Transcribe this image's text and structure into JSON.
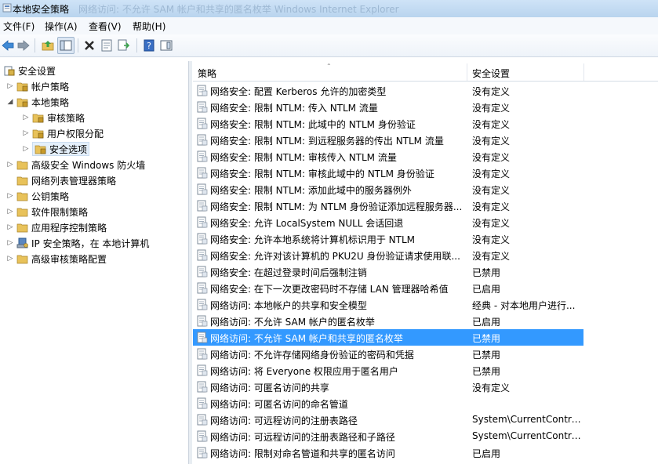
{
  "window": {
    "title": "本地安全策略",
    "ghost_title": "网络访问: 不允许 SAM 帐户和共享的匿名枚举  Windows Internet Explorer"
  },
  "menu": [
    {
      "label": "文件(F)"
    },
    {
      "label": "操作(A)"
    },
    {
      "label": "查看(V)"
    },
    {
      "label": "帮助(H)"
    }
  ],
  "toolbar": {
    "icons": [
      "back-arrow-icon",
      "forward-arrow-icon",
      "up-folder-icon",
      "show-hide-tree-icon",
      "delete-icon",
      "properties-icon",
      "export-list-icon",
      "help-icon",
      "console-pane-icon"
    ]
  },
  "tree": {
    "root": "安全设置",
    "items": [
      {
        "label": "帐户策略",
        "level": 1,
        "expander": "closed",
        "icon": "folder-lock"
      },
      {
        "label": "本地策略",
        "level": 1,
        "expander": "open",
        "icon": "folder-lock"
      },
      {
        "label": "审核策略",
        "level": 2,
        "expander": "closed",
        "icon": "folder-lock"
      },
      {
        "label": "用户权限分配",
        "level": 2,
        "expander": "closed",
        "icon": "folder-lock"
      },
      {
        "label": "安全选项",
        "level": 2,
        "expander": "closed",
        "icon": "folder-lock",
        "selected": true
      },
      {
        "label": "高级安全 Windows 防火墙",
        "level": 1,
        "expander": "closed",
        "icon": "folder"
      },
      {
        "label": "网络列表管理器策略",
        "level": 1,
        "expander": "none",
        "icon": "folder"
      },
      {
        "label": "公钥策略",
        "level": 1,
        "expander": "closed",
        "icon": "folder"
      },
      {
        "label": "软件限制策略",
        "level": 1,
        "expander": "closed",
        "icon": "folder"
      },
      {
        "label": "应用程序控制策略",
        "level": 1,
        "expander": "closed",
        "icon": "folder"
      },
      {
        "label": "IP 安全策略，在 本地计算机",
        "level": 1,
        "expander": "closed",
        "icon": "ipsec"
      },
      {
        "label": "高级审核策略配置",
        "level": 1,
        "expander": "closed",
        "icon": "folder"
      }
    ]
  },
  "table": {
    "headers": {
      "policy": "策略",
      "setting": "安全设置"
    },
    "rows": [
      {
        "policy": "网络安全: 配置 Kerberos 允许的加密类型",
        "setting": "没有定义"
      },
      {
        "policy": "网络安全: 限制 NTLM: 传入 NTLM 流量",
        "setting": "没有定义"
      },
      {
        "policy": "网络安全: 限制 NTLM: 此域中的 NTLM 身份验证",
        "setting": "没有定义"
      },
      {
        "policy": "网络安全: 限制 NTLM: 到远程服务器的传出 NTLM 流量",
        "setting": "没有定义"
      },
      {
        "policy": "网络安全: 限制 NTLM: 审核传入 NTLM 流量",
        "setting": "没有定义"
      },
      {
        "policy": "网络安全: 限制 NTLM: 审核此域中的 NTLM 身份验证",
        "setting": "没有定义"
      },
      {
        "policy": "网络安全: 限制 NTLM: 添加此域中的服务器例外",
        "setting": "没有定义"
      },
      {
        "policy": "网络安全: 限制 NTLM: 为 NTLM 身份验证添加远程服务器...",
        "setting": "没有定义"
      },
      {
        "policy": "网络安全: 允许 LocalSystem NULL 会话回退",
        "setting": "没有定义"
      },
      {
        "policy": "网络安全: 允许本地系统将计算机标识用于 NTLM",
        "setting": "没有定义"
      },
      {
        "policy": "网络安全: 允许对该计算机的 PKU2U 身份验证请求使用联...",
        "setting": "没有定义"
      },
      {
        "policy": "网络安全: 在超过登录时间后强制注销",
        "setting": "已禁用"
      },
      {
        "policy": "网络安全: 在下一次更改密码时不存储 LAN 管理器哈希值",
        "setting": "已启用"
      },
      {
        "policy": "网络访问: 本地帐户的共享和安全模型",
        "setting": "经典 - 对本地用户进行..."
      },
      {
        "policy": "网络访问: 不允许 SAM 帐户的匿名枚举",
        "setting": "已启用"
      },
      {
        "policy": "网络访问: 不允许 SAM 帐户和共享的匿名枚举",
        "setting": "已禁用",
        "selected": true
      },
      {
        "policy": "网络访问: 不允许存储网络身份验证的密码和凭据",
        "setting": "已禁用"
      },
      {
        "policy": "网络访问: 将 Everyone 权限应用于匿名用户",
        "setting": "已禁用"
      },
      {
        "policy": "网络访问: 可匿名访问的共享",
        "setting": "没有定义"
      },
      {
        "policy": "网络访问: 可匿名访问的命名管道",
        "setting": ""
      },
      {
        "policy": "网络访问: 可远程访问的注册表路径",
        "setting": "System\\CurrentContro..."
      },
      {
        "policy": "网络访问: 可远程访问的注册表路径和子路径",
        "setting": "System\\CurrentContro..."
      },
      {
        "policy": "网络访问: 限制对命名管道和共享的匿名访问",
        "setting": "已启用"
      }
    ]
  },
  "colors": {
    "selection": "#3399ff",
    "folder": "#e8c25a",
    "lock": "#c79a2a"
  }
}
